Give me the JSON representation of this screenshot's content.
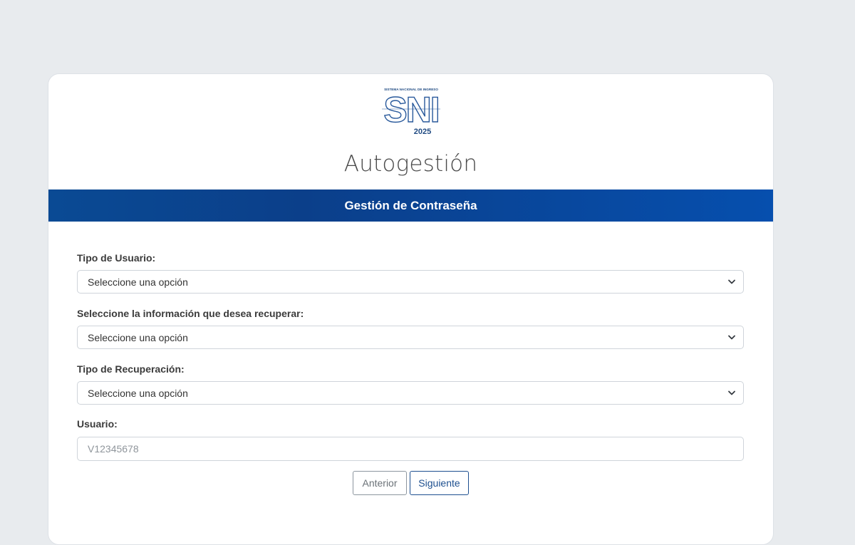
{
  "logo": {
    "tagline": "SISTEMA NACIONAL DE INGRESO",
    "letters": "SNI",
    "year": "2025"
  },
  "page_title": "Autogestión",
  "banner_title": "Gestión de Contraseña",
  "form": {
    "user_type": {
      "label": "Tipo de Usuario:",
      "selected": "Seleccione una opción"
    },
    "recover_info": {
      "label": "Seleccione la información que desea recuperar:",
      "selected": "Seleccione una opción"
    },
    "recovery_type": {
      "label": "Tipo de Recuperación:",
      "selected": "Seleccione una opción"
    },
    "username": {
      "label": "Usuario:",
      "placeholder": "V12345678",
      "value": ""
    }
  },
  "buttons": {
    "previous": "Anterior",
    "next": "Siguiente"
  },
  "colors": {
    "banner": "#0b4b9c",
    "primary": "#1d4f8f",
    "background": "#e8ebee"
  }
}
